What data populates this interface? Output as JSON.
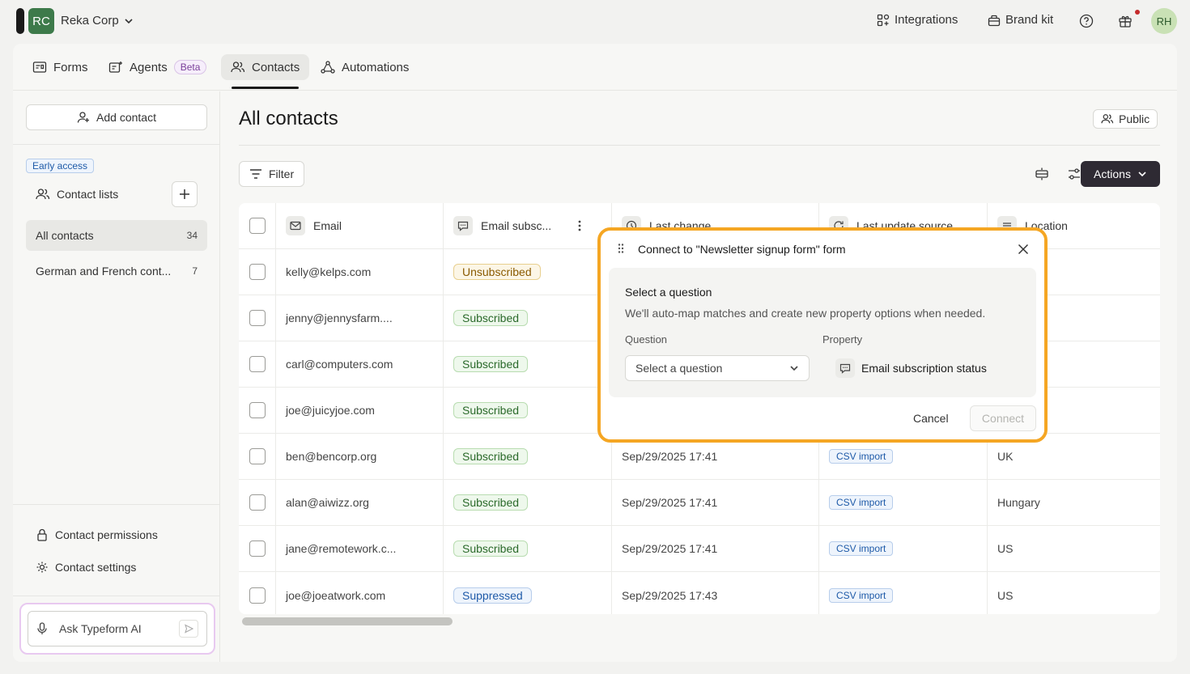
{
  "topbar": {
    "workspace_initials": "RC",
    "workspace_name": "Reka Corp",
    "integrations_label": "Integrations",
    "brand_kit_label": "Brand kit",
    "user_initials": "RH"
  },
  "tabs": [
    {
      "label": "Forms"
    },
    {
      "label": "Agents",
      "badge": "Beta"
    },
    {
      "label": "Contacts"
    },
    {
      "label": "Automations"
    }
  ],
  "sidebar": {
    "add_contact_label": "Add contact",
    "early_access_badge": "Early access",
    "contact_lists_label": "Contact lists",
    "lists": [
      {
        "label": "All contacts",
        "count": "34"
      },
      {
        "label": "German and French cont...",
        "count": "7"
      }
    ],
    "permissions_label": "Contact permissions",
    "settings_label": "Contact settings",
    "ask_ai_placeholder": "Ask Typeform AI"
  },
  "main": {
    "title": "All contacts",
    "public_label": "Public",
    "filter_label": "Filter",
    "actions_label": "Actions"
  },
  "table": {
    "columns": [
      "Email",
      "Email subsc...",
      "Last change",
      "Last update source",
      "Location"
    ],
    "rows": [
      {
        "email": "kelly@kelps.com",
        "status": "Unsubscribed",
        "status_kind": "unsub",
        "last_change": "",
        "source": "",
        "location": ""
      },
      {
        "email": "jenny@jennysfarm....",
        "status": "Subscribed",
        "status_kind": "sub",
        "last_change": "",
        "source": "",
        "location": ""
      },
      {
        "email": "carl@computers.com",
        "status": "Subscribed",
        "status_kind": "sub",
        "last_change": "",
        "source": "",
        "location": ""
      },
      {
        "email": "joe@juicyjoe.com",
        "status": "Subscribed",
        "status_kind": "sub",
        "last_change": "",
        "source": "",
        "location": ""
      },
      {
        "email": "ben@bencorp.org",
        "status": "Subscribed",
        "status_kind": "sub",
        "last_change": "Sep/29/2025 17:41",
        "source": "CSV import",
        "location": "UK"
      },
      {
        "email": "alan@aiwizz.org",
        "status": "Subscribed",
        "status_kind": "sub",
        "last_change": "Sep/29/2025 17:41",
        "source": "CSV import",
        "location": "Hungary"
      },
      {
        "email": "jane@remotework.c...",
        "status": "Subscribed",
        "status_kind": "sub",
        "last_change": "Sep/29/2025 17:41",
        "source": "CSV import",
        "location": "US"
      },
      {
        "email": "joe@joeatwork.com",
        "status": "Suppressed",
        "status_kind": "supp",
        "last_change": "Sep/29/2025 17:43",
        "source": "CSV import",
        "location": "US"
      }
    ]
  },
  "dialog": {
    "title": "Connect to \"Newsletter signup form\" form",
    "heading": "Select a question",
    "description": "We'll auto-map matches and create new property options when needed.",
    "question_label": "Question",
    "property_label": "Property",
    "select_placeholder": "Select a question",
    "property_value": "Email subscription status",
    "cancel_label": "Cancel",
    "connect_label": "Connect"
  },
  "colors": {
    "highlight": "#f5a623",
    "actions_bg": "#2e2a33",
    "workspace_avatar": "#3d7a4a"
  }
}
